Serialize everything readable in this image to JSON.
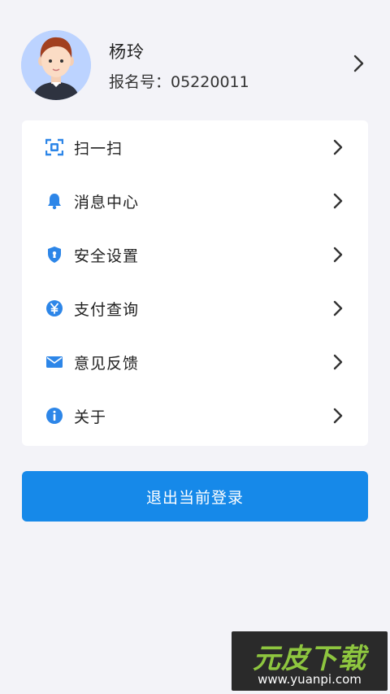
{
  "profile": {
    "name": "杨玲",
    "registration_label": "报名号：05220011"
  },
  "menu": {
    "items": [
      {
        "label": "扫一扫",
        "icon": "scan-icon"
      },
      {
        "label": "消息中心",
        "icon": "bell-icon"
      },
      {
        "label": "安全设置",
        "icon": "shield-icon"
      },
      {
        "label": "支付查询",
        "icon": "yen-icon"
      },
      {
        "label": "意见反馈",
        "icon": "mail-icon"
      },
      {
        "label": "关于",
        "icon": "info-icon"
      }
    ]
  },
  "logout": {
    "label": "退出当前登录"
  },
  "watermark": {
    "logo_text": "元皮下载",
    "url": "www.yuanpi.com"
  },
  "colors": {
    "accent": "#1689e9",
    "icon": "#2d86e8",
    "background": "#f3f3f8",
    "card": "#ffffff"
  }
}
